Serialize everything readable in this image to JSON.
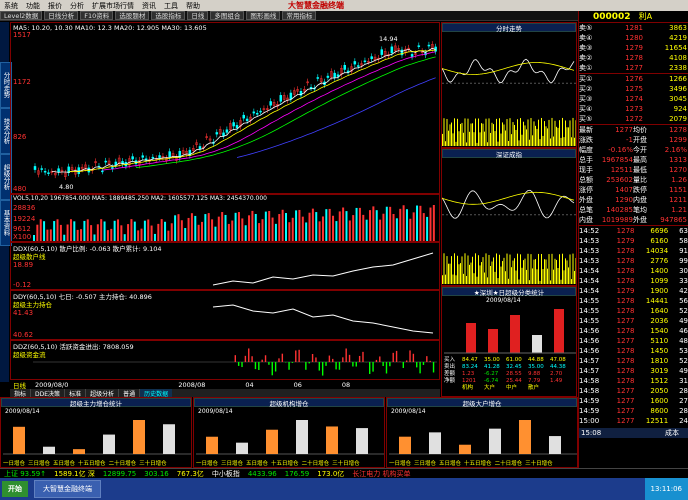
{
  "menubar": {
    "items": [
      "系统",
      "功能",
      "报价",
      "分析",
      "扩展市场行情",
      "资讯",
      "工具",
      "帮助"
    ],
    "brand": "大智慧金融终端",
    "clock": "13:11:06"
  },
  "toolbar": {
    "items": [
      "Level2数据",
      "日线分析",
      "F10资料",
      "选股题材",
      "选股指标",
      "日线",
      "多图组合",
      "图形画线",
      "常用指标"
    ],
    "code": "000002",
    "name": "万 科A"
  },
  "chart": {
    "high_label": "14.94",
    "low_label": "4.80",
    "y_ticks": [
      "1517",
      "1172",
      "826",
      "480"
    ],
    "vol_ticks": [
      "28836",
      "19224",
      "9612",
      "X100"
    ],
    "ma_line": "MA5: 10.20, 10.30  MA10: 12.3  MA20: 12.905  MA30: 13.605",
    "vol_line": "VOL5,10,20  1967854.000  MA5: 1889485.250  MA2: 1605577.125  MA3: 2454370.000"
  },
  "ind1": {
    "line": "DDX(60,5,10)  散户比例: -0.063  散户累计: 9.104",
    "name": "超级散户线",
    "ticks": [
      "18.89",
      "-0.12"
    ]
  },
  "ind2": {
    "line": "DDY(60,5,10)  七日: -0.507  主力持仓: 40.896",
    "name": "超级主力持仓",
    "ticks": [
      "41.43",
      "40.62"
    ]
  },
  "ind3": {
    "line": "DDZ(60,5,10)  活跃资金进出: 7808.059",
    "name": "超级资金流"
  },
  "timeaxis": {
    "left": "日线",
    "year": "2009/08/0",
    "dates": [
      "2008/08",
      "02",
      "03",
      "04",
      "05",
      "06",
      "07",
      "08"
    ]
  },
  "tabs": [
    "指标",
    "DDE决策",
    "标准",
    "超级分析",
    "普通",
    "历史数据"
  ],
  "mini1": {
    "title": "分时走势"
  },
  "mini2": {
    "title": "深证成指"
  },
  "mini3": {
    "title": "★深圳★日超级分类统计",
    "date": "2009/08/14",
    "bar_labels": [
      "42.78亿",
      "12.73亿",
      "60.01亿",
      "-3.0%",
      "-3.51亿",
      "-3.85%",
      "-3.90亿"
    ],
    "rows": [
      [
        "买入",
        "84.47",
        "35.00",
        "61.00",
        "44.88",
        "47.08"
      ],
      [
        "卖出",
        "83.24",
        "41.28",
        "32.45",
        "35.00",
        "44.38"
      ],
      [
        "差额",
        "1.23",
        "-6.27",
        "28.55",
        "9.88",
        "2.70"
      ],
      [
        "净额",
        "1201",
        "-6.74",
        "25.44",
        "7.79",
        "1.49"
      ],
      [
        "机构",
        "大户",
        "中户",
        "散户"
      ]
    ]
  },
  "bottom": [
    {
      "title": "超级主力增仓统计",
      "date": "2009/08/14",
      "axis": [
        "一日增仓",
        "三日增仓",
        "五日增仓",
        "十五日增仓",
        "二十日增仓",
        "三十日增仓"
      ],
      "value": "93.59↑",
      "value2": "1589.1亿",
      "values": [
        4.48,
        1.2,
        0.8,
        3.2,
        5.6,
        4.9
      ]
    },
    {
      "title": "超级机构增仓",
      "date": "2009/08/14",
      "axis": [
        "一日增仓",
        "三日增仓",
        "五日增仓",
        "十五日增仓",
        "二十日增仓",
        "三十日增仓"
      ],
      "value": "12899.75",
      "value2": "303.16",
      "values": [
        3.2,
        2.1,
        4.5,
        6.3,
        5.1,
        4.8
      ]
    },
    {
      "title": "超级大户增仓",
      "date": "2009/08/14",
      "axis": [
        "一日增仓",
        "三日增仓",
        "五日增仓",
        "十五日增仓",
        "二十日增仓",
        "三十日增仓"
      ],
      "value": "767.3亿",
      "value2": "4433.96",
      "values": [
        2.8,
        3.5,
        1.5,
        4.1,
        5.5,
        2.9
      ]
    }
  ],
  "status": {
    "a": "上证 93.59↑",
    "b": "1589.1亿 深",
    "c": "12899.75",
    "d": "303.16",
    "e": "767.3亿",
    "f": "中小板指",
    "g": "4433.96",
    "h": "176.59",
    "i": "173.0亿",
    "j": "长江电力 机构买单",
    "k": "13:11:06"
  },
  "quote": {
    "code": "000002",
    "name": "万 科A",
    "tag": "利A",
    "sell": [
      [
        "卖⑤",
        "1281",
        "3863"
      ],
      [
        "卖④",
        "1280",
        "4219"
      ],
      [
        "卖③",
        "1279",
        "11654"
      ],
      [
        "卖②",
        "1278",
        "4108"
      ],
      [
        "卖①",
        "1277",
        "2338"
      ]
    ],
    "buy": [
      [
        "买①",
        "1276",
        "1266"
      ],
      [
        "买②",
        "1275",
        "3496"
      ],
      [
        "买③",
        "1274",
        "3045"
      ],
      [
        "买④",
        "1273",
        "924"
      ],
      [
        "买⑤",
        "1272",
        "2079"
      ]
    ],
    "info": [
      [
        "最新",
        "1277",
        "均价",
        "1278"
      ],
      [
        "涨跌",
        "-1",
        "开盘",
        "1299"
      ],
      [
        "幅度",
        "-0.16%",
        "今开",
        "2.16%"
      ],
      [
        "总手",
        "1967854",
        "最高",
        "1313"
      ],
      [
        "现手",
        "12511",
        "最低",
        "1270"
      ],
      [
        "总额",
        "253602",
        "量比",
        "1.26"
      ],
      [
        "涨停",
        "1407",
        "跌停",
        "1151"
      ],
      [
        "外盘",
        "1290",
        "内盘",
        "1211"
      ],
      [
        "总笔",
        "140285",
        "笔均",
        "1.21"
      ],
      [
        "内盘",
        "1019989",
        "外盘",
        "947865"
      ]
    ],
    "ticks": [
      [
        "14:52",
        "1278",
        "6696",
        "63"
      ],
      [
        "14:53",
        "1279",
        "6160",
        "58"
      ],
      [
        "14:53",
        "1278",
        "14034",
        "91"
      ],
      [
        "14:53",
        "1278",
        "2776",
        "99"
      ],
      [
        "14:54",
        "1278",
        "1400",
        "30"
      ],
      [
        "14:54",
        "1278",
        "1099",
        "33"
      ],
      [
        "14:54",
        "1279",
        "1900",
        "42"
      ],
      [
        "14:55",
        "1278",
        "14441",
        "56"
      ],
      [
        "14:55",
        "1278",
        "1640",
        "52"
      ],
      [
        "14:55",
        "1277",
        "2036",
        "49"
      ],
      [
        "14:56",
        "1278",
        "1540",
        "46"
      ],
      [
        "14:56",
        "1277",
        "5110",
        "48"
      ],
      [
        "14:56",
        "1278",
        "1450",
        "53"
      ],
      [
        "14:57",
        "1278",
        "1810",
        "52"
      ],
      [
        "14:57",
        "1278",
        "3019",
        "49"
      ],
      [
        "14:58",
        "1278",
        "1512",
        "31"
      ],
      [
        "14:58",
        "1277",
        "2050",
        "28"
      ],
      [
        "14:59",
        "1277",
        "1600",
        "27"
      ],
      [
        "14:59",
        "1277",
        "8600",
        "28"
      ],
      [
        "15:00",
        "1277",
        "12511",
        "24"
      ]
    ],
    "bottom_left": "15:08",
    "bottom_right": "成本"
  },
  "chart_data": {
    "type": "candlestick",
    "ylim": [
      480,
      1517
    ],
    "y_ticks": [
      480,
      826,
      1172,
      1517
    ]
  }
}
